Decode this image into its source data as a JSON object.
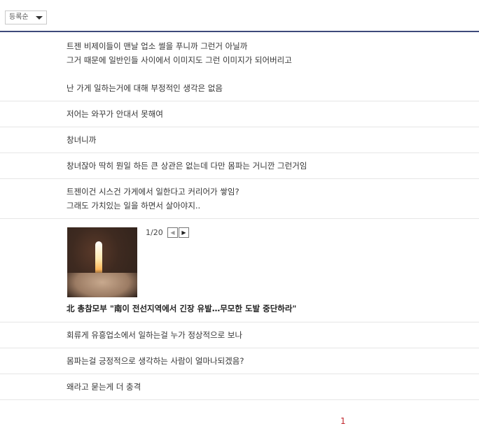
{
  "sort": {
    "selected": "등록순"
  },
  "comments": [
    {
      "lines": [
        "트젠 비제이들이 맨날 업소 썰을 푸니까 그런거 아닐까",
        "그거 때문에 일반인들 사이에서 이미지도 그런 이미지가 되어버리고",
        "",
        "난 가게 일하는거에 대해 부정적인 생각은 없음"
      ]
    },
    {
      "lines": [
        "저어는 와꾸가 안대서 못해여"
      ]
    },
    {
      "lines": [
        "창녀니까"
      ]
    },
    {
      "lines": [
        "창녀잖아 딱히 뭔일 하든 큰 상관은 없는데 다만 몸파는 거니깐 그런거임"
      ]
    },
    {
      "lines": [
        "트젠이건 시스건 가게에서 일한다고 커리어가 쌓임?",
        "그래도 가치있는 일을 하면서 살아야지.."
      ]
    }
  ],
  "news": {
    "counter": "1/20",
    "prev_icon": "chevron-left-icon",
    "next_icon": "chevron-right-icon",
    "headline": "北 총참모부 \"南이 전선지역에서 긴장 유발…무모한 도발 중단하라\""
  },
  "comments_after": [
    {
      "lines": [
        "회류게 유흥업소에서 일하는걸 누가 정상적으로 보나"
      ]
    },
    {
      "lines": [
        "몸파는걸 긍정적으로 생각하는 사람이 얼마나되겠음?"
      ]
    },
    {
      "lines": [
        "왜라고 묻는게 더 충격"
      ]
    }
  ],
  "pagination": {
    "current": "1"
  },
  "colors": {
    "topbar_border": "#3d4a7a",
    "page_num": "#c1272d"
  }
}
